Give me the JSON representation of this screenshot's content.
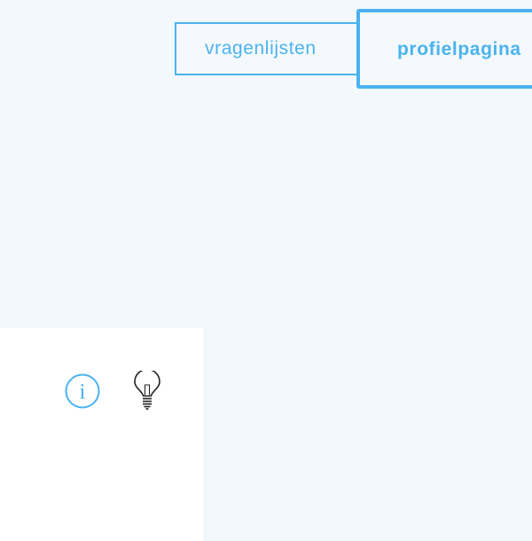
{
  "tabs": {
    "questionnaires_label": "vragenlijsten",
    "profile_label": "profielpagina"
  },
  "card": {
    "icons": [
      "info-icon",
      "lightbulb-icon"
    ]
  },
  "colors": {
    "accent": "#4ab3ef",
    "page_background": "#f3f8fd",
    "card_background": "#ffffff",
    "icon_dark": "#222222"
  }
}
